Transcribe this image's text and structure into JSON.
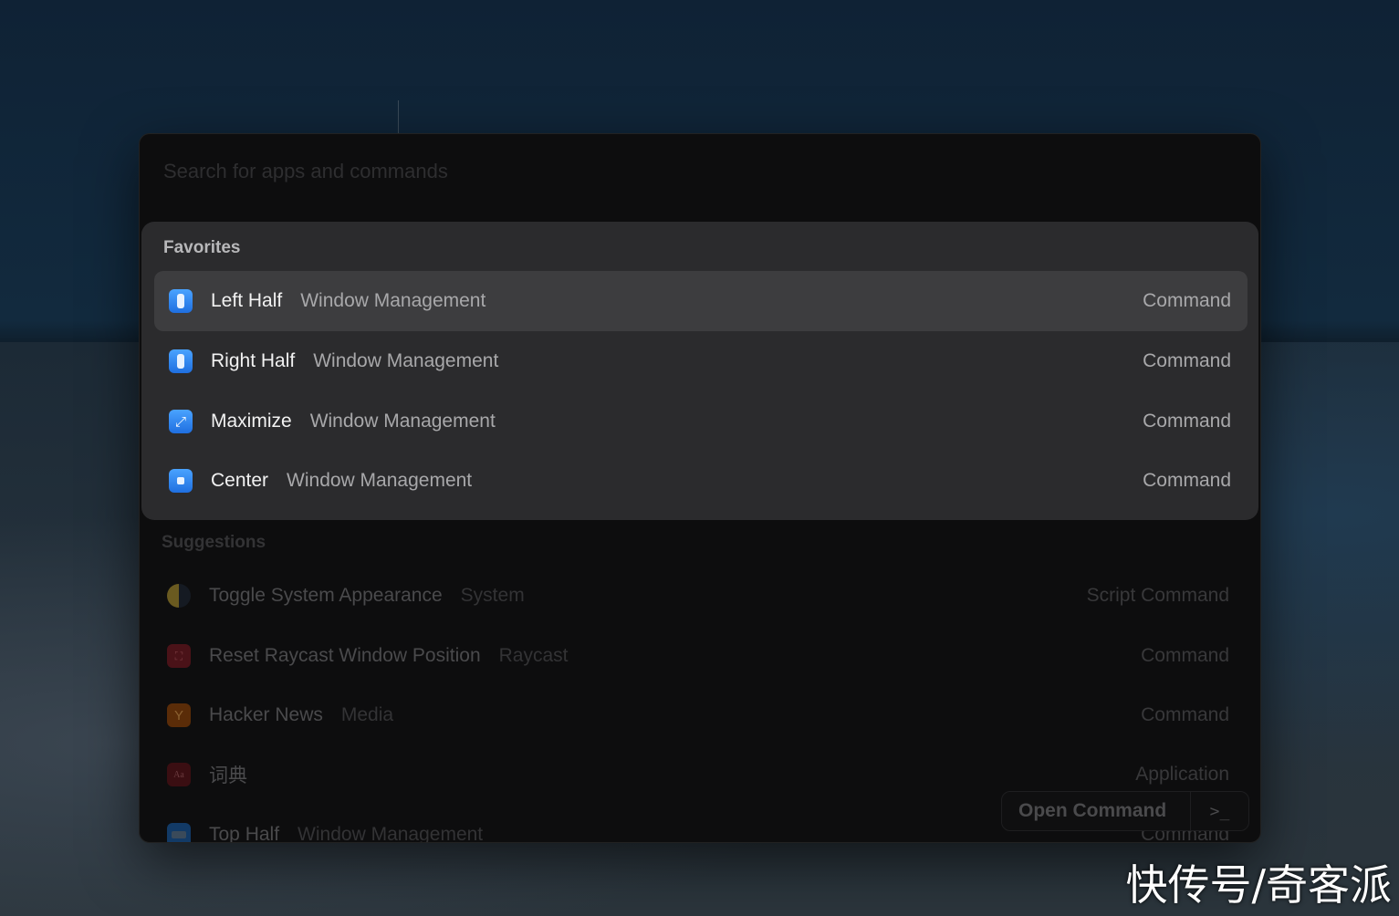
{
  "search": {
    "placeholder": "Search for apps and commands",
    "value": ""
  },
  "favorites": {
    "title": "Favorites",
    "items": [
      {
        "title": "Left Half",
        "subtitle": "Window Management",
        "kind": "Command",
        "icon": "left-half-icon",
        "selected": true
      },
      {
        "title": "Right Half",
        "subtitle": "Window Management",
        "kind": "Command",
        "icon": "right-half-icon"
      },
      {
        "title": "Maximize",
        "subtitle": "Window Management",
        "kind": "Command",
        "icon": "maximize-icon"
      },
      {
        "title": "Center",
        "subtitle": "Window Management",
        "kind": "Command",
        "icon": "center-icon"
      }
    ]
  },
  "suggestions": {
    "title": "Suggestions",
    "items": [
      {
        "title": "Toggle System Appearance",
        "subtitle": "System",
        "kind": "Script Command",
        "icon": "moon-icon"
      },
      {
        "title": "Reset Raycast Window Position",
        "subtitle": "Raycast",
        "kind": "Command",
        "icon": "reset-position-icon"
      },
      {
        "title": "Hacker News",
        "subtitle": "Media",
        "kind": "Command",
        "icon": "hacker-news-icon",
        "glyph": "Y"
      },
      {
        "title": "词典",
        "subtitle": "",
        "kind": "Application",
        "icon": "dictionary-icon",
        "glyph": "Aa"
      },
      {
        "title": "Top Half",
        "subtitle": "Window Management",
        "kind": "Command",
        "icon": "top-half-icon"
      }
    ]
  },
  "action": {
    "label": "Open Command",
    "shortcut": ">_"
  },
  "watermark": "快传号/奇客派",
  "colors": {
    "accent": "#2f86f0",
    "selected_row": "#3d3d3f",
    "panel": "#2b2b2d"
  }
}
